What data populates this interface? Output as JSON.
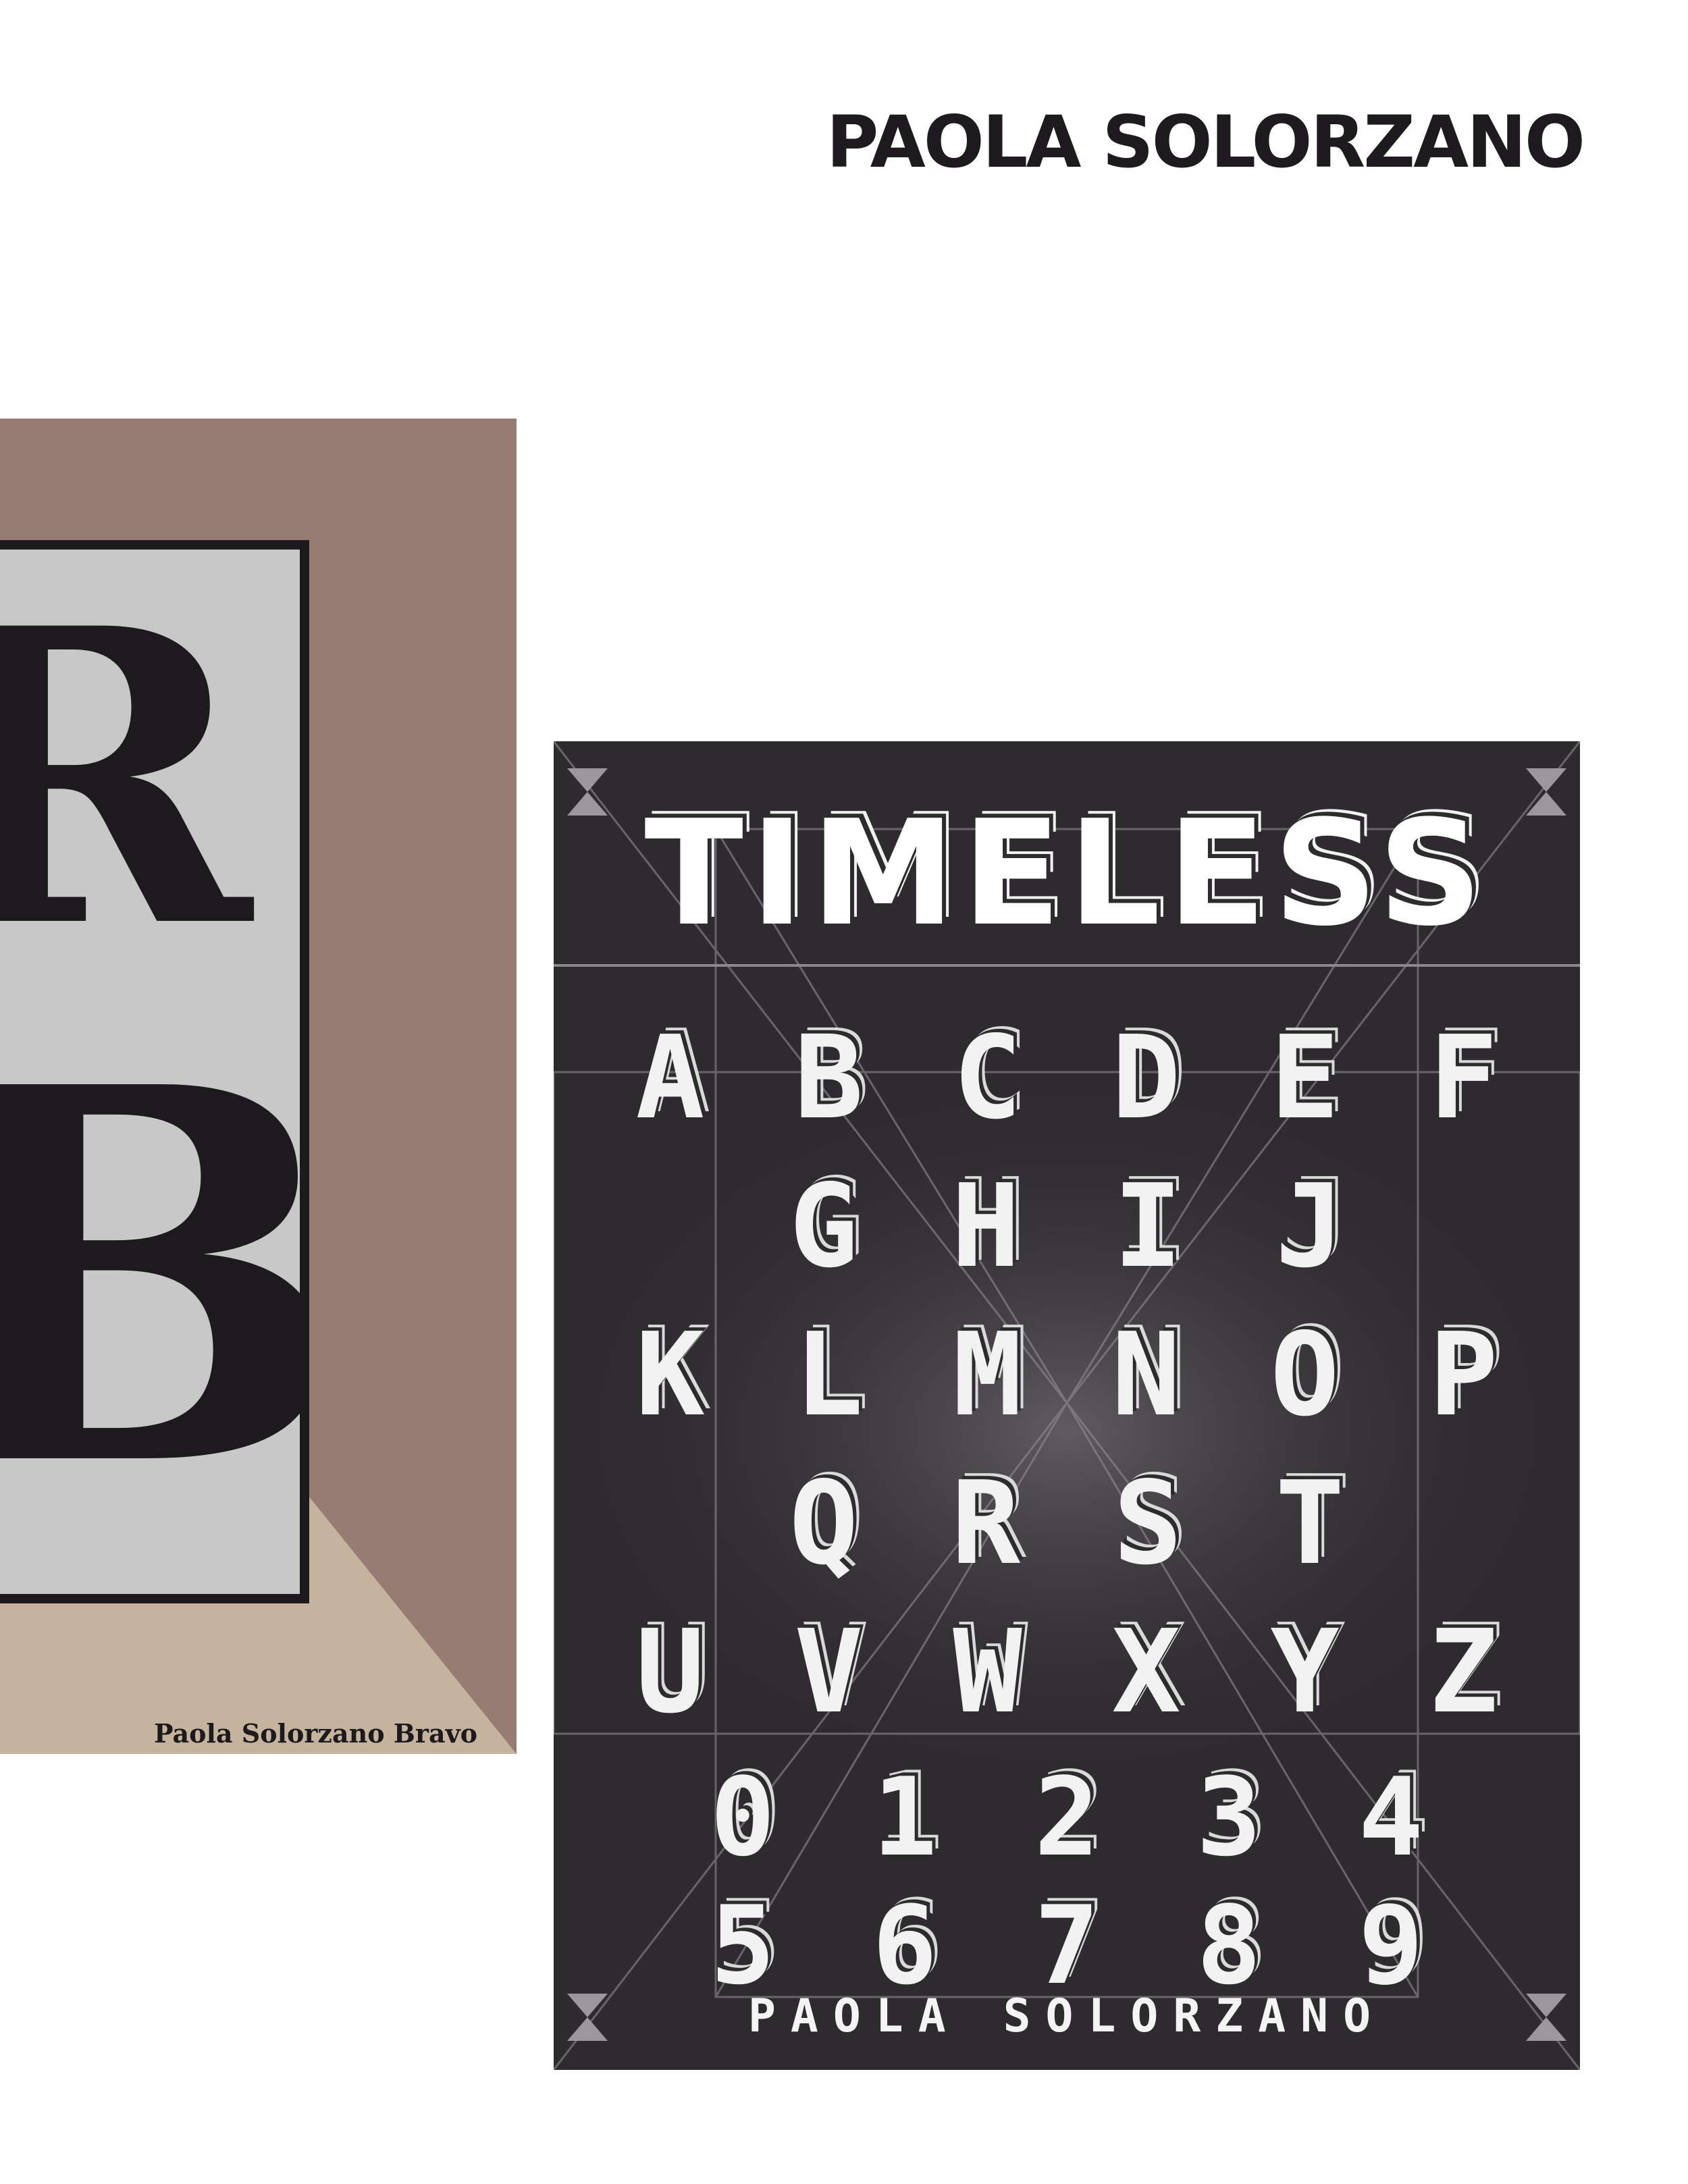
{
  "header": {
    "name": "PAOLA SOLORZANO"
  },
  "left_poster": {
    "glyph_top": "R",
    "glyph_bottom": "B",
    "credit": "Paola Solorzano Bravo",
    "colors": {
      "background": "#967c72",
      "triangle": "#c6b39e",
      "frame": "#c8c8c8",
      "ink": "#1c1a1c"
    }
  },
  "right_poster": {
    "title": "TIMELESS",
    "rows": [
      [
        "A",
        "B",
        "C",
        "D",
        "E",
        "F"
      ],
      [
        "G",
        "H",
        "I",
        "J"
      ],
      [
        "K",
        "L",
        "M",
        "N",
        "O",
        "P"
      ],
      [
        "Q",
        "R",
        "S",
        "T"
      ],
      [
        "U",
        "V",
        "W",
        "X",
        "Y",
        "Z"
      ],
      [
        "0",
        "1",
        "2",
        "3",
        "4"
      ],
      [
        "5",
        "6",
        "7",
        "8",
        "9"
      ]
    ],
    "footer": "PAOLA SOLORZANO",
    "colors": {
      "background": "#2d2b2e",
      "glyph": "#f2f2f2"
    }
  }
}
